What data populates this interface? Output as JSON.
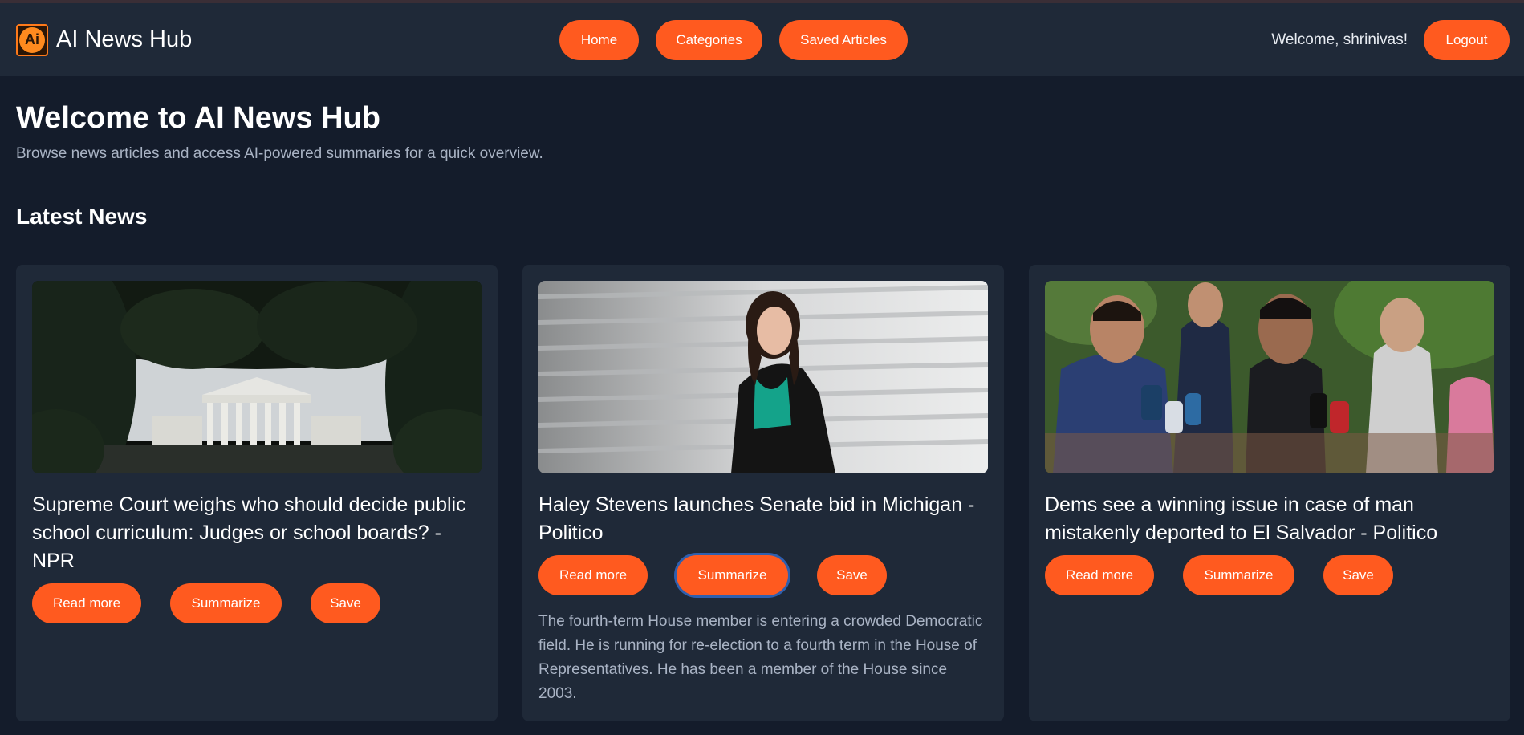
{
  "header": {
    "brand_title": "AI News Hub",
    "logo_text": "Ai",
    "nav": [
      "Home",
      "Categories",
      "Saved Articles"
    ],
    "welcome_text": "Welcome, shrinivas!",
    "logout_label": "Logout"
  },
  "hero": {
    "title": "Welcome to AI News Hub",
    "subtitle": "Browse news articles and access AI-powered summaries for a quick overview."
  },
  "latest": {
    "section_title": "Latest News",
    "articles": [
      {
        "title": "Supreme Court weighs who should decide public school curriculum: Judges or school boards? - NPR",
        "read_label": "Read more",
        "summarize_label": "Summarize",
        "save_label": "Save",
        "summary": ""
      },
      {
        "title": "Haley Stevens launches Senate bid in Michigan - Politico",
        "read_label": "Read more",
        "summarize_label": "Summarize",
        "save_label": "Save",
        "summary": "The fourth-term House member is entering a crowded Democratic field. He is running for re-election to a fourth term in the House of Representatives. He has been a member of the House since 2003."
      },
      {
        "title": "Dems see a winning issue in case of man mistakenly deported to El Salvador - Politico",
        "read_label": "Read more",
        "summarize_label": "Summarize",
        "save_label": "Save",
        "summary": ""
      }
    ]
  },
  "colors": {
    "accent": "#ff5a1f",
    "background": "#141c2b",
    "panel": "#1f2938",
    "muted_text": "#a9b3c4"
  }
}
